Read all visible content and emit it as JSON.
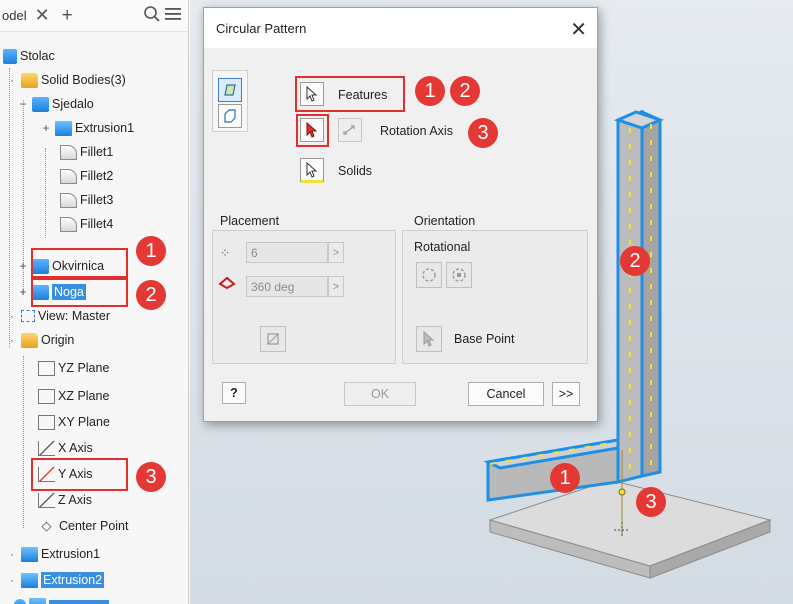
{
  "browser": {
    "tab_label": "odel",
    "tab_close": "✕",
    "tab_add": "+",
    "search_icon": "search-icon",
    "menu_icon": "menu-icon",
    "tree": {
      "root": "Stolac",
      "solid_bodies": "Solid Bodies(3)",
      "sjedalo": "Sjedalo",
      "extrusion1_a": "Extrusion1",
      "fillet1": "Fillet1",
      "fillet2": "Fillet2",
      "fillet3": "Fillet3",
      "fillet4": "Fillet4",
      "okvirnica": "Okvirnica",
      "noga": "Noga",
      "view_master": "View: Master",
      "origin": "Origin",
      "yz_plane": "YZ Plane",
      "xz_plane": "XZ Plane",
      "xy_plane": "XY Plane",
      "x_axis": "X Axis",
      "y_axis": "Y Axis",
      "z_axis": "Z Axis",
      "center_point": "Center Point",
      "extrusion1_b": "Extrusion1",
      "extrusion2": "Extrusion2"
    }
  },
  "dialog": {
    "title": "Circular Pattern",
    "close": "✕",
    "features_label": "Features",
    "rotation_axis_label": "Rotation Axis",
    "solids_label": "Solids",
    "placement_label": "Placement",
    "count_value": "6",
    "angle_value": "360 deg",
    "orientation_label": "Orientation",
    "rotational_label": "Rotational",
    "base_point_label": "Base Point",
    "ok_label": "OK",
    "cancel_label": "Cancel",
    "more_label": ">>",
    "help_label": "?"
  },
  "markers": {
    "m1": "1",
    "m2": "2",
    "m3": "3"
  },
  "colors": {
    "accent_red": "#e43834",
    "selection_blue": "#3b8fe0",
    "highlight_cyan": "#1e8fe6",
    "yellow_dash": "#f2e03a"
  }
}
